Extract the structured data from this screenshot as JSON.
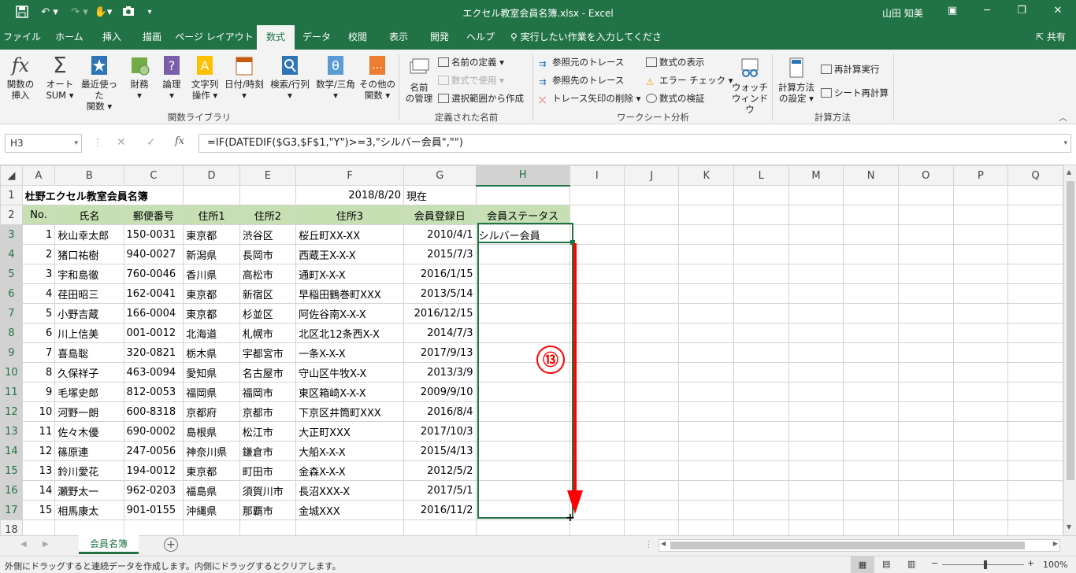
{
  "app": {
    "title": "エクセル教室会員名簿.xlsx  -  Excel",
    "user": "山田 知美",
    "share": "共有"
  },
  "tabs": [
    "ファイル",
    "ホーム",
    "挿入",
    "描画",
    "ページ レイアウト",
    "数式",
    "データ",
    "校閲",
    "表示",
    "開発",
    "ヘルプ"
  ],
  "search_placeholder": "実行したい作業を入力してください",
  "ribbon": {
    "fx_label1": "関数の",
    "fx_label2": "挿入",
    "sum1": "オート",
    "sum2": "SUM",
    "recent1": "最近使った",
    "recent2": "関数",
    "fin": "財務",
    "logic": "論理",
    "text1": "文字列",
    "text2": "操作",
    "date": "日付/時刻",
    "lookup": "検索/行列",
    "math": "数学/三角",
    "other1": "その他の",
    "other2": "関数",
    "grp_lib": "関数ライブラリ",
    "name1": "名前",
    "name2": "の管理",
    "define_name": "名前の定義",
    "use_formula": "数式で使用",
    "create_sel": "選択範囲から作成",
    "grp_names": "定義された名前",
    "trace_prec": "参照元のトレース",
    "trace_dep": "参照先のトレース",
    "remove_arrows": "トレース矢印の削除",
    "show_formulas": "数式の表示",
    "error_check": "エラー チェック",
    "eval_formula": "数式の検証",
    "watch1": "ウォッチ",
    "watch2": "ウィンドウ",
    "grp_audit": "ワークシート分析",
    "calc1": "計算方法",
    "calc2": "の設定",
    "calc_now": "再計算実行",
    "calc_sheet": "シート再計算",
    "grp_calc": "計算方法",
    "icon_fx": "fx",
    "icon_sum": "Σ"
  },
  "formula_bar": {
    "name_box": "H3",
    "fx": "fx",
    "formula": "=IF(DATEDIF($G3,$F$1,\"Y\")>=3,\"シルバー会員\",\"\")"
  },
  "columns": [
    "A",
    "B",
    "C",
    "D",
    "E",
    "F",
    "G",
    "H",
    "I",
    "J",
    "K",
    "L",
    "M",
    "N",
    "O",
    "P",
    "Q"
  ],
  "sheet": {
    "title": "杜野エクセル教室会員名簿",
    "ref_date": "2018/8/20",
    "ref_label": "現在",
    "headers": [
      "No.",
      "氏名",
      "郵便番号",
      "住所1",
      "住所2",
      "住所3",
      "会員登録日",
      "会員ステータス"
    ],
    "rows": [
      [
        "1",
        "秋山幸太郎",
        "150-0031",
        "東京都",
        "渋谷区",
        "桜丘町XX-XX",
        "2010/4/1",
        "シルバー会員"
      ],
      [
        "2",
        "猪口祐樹",
        "940-0027",
        "新潟県",
        "長岡市",
        "西蔵王X-X-X",
        "2015/7/3",
        ""
      ],
      [
        "3",
        "宇和島徹",
        "760-0046",
        "香川県",
        "高松市",
        "通町X-X-X",
        "2016/1/15",
        ""
      ],
      [
        "4",
        "荏田昭三",
        "162-0041",
        "東京都",
        "新宿区",
        "早稲田鶴巻町XXX",
        "2013/5/14",
        ""
      ],
      [
        "5",
        "小野吉蔵",
        "166-0004",
        "東京都",
        "杉並区",
        "阿佐谷南X-X-X",
        "2016/12/15",
        ""
      ],
      [
        "6",
        "川上信美",
        "001-0012",
        "北海道",
        "札幌市",
        "北区北12条西X-X",
        "2014/7/3",
        ""
      ],
      [
        "7",
        "喜島聡",
        "320-0821",
        "栃木県",
        "宇都宮市",
        "一条X-X-X",
        "2017/9/13",
        ""
      ],
      [
        "8",
        "久保祥子",
        "463-0094",
        "愛知県",
        "名古屋市",
        "守山区牛牧X-X",
        "2013/3/9",
        ""
      ],
      [
        "9",
        "毛塚史郎",
        "812-0053",
        "福岡県",
        "福岡市",
        "東区箱崎X-X-X",
        "2009/9/10",
        ""
      ],
      [
        "10",
        "河野一朗",
        "600-8318",
        "京都府",
        "京都市",
        "下京区井筒町XXX",
        "2016/8/4",
        ""
      ],
      [
        "11",
        "佐々木優",
        "690-0002",
        "島根県",
        "松江市",
        "大正町XXX",
        "2017/10/3",
        ""
      ],
      [
        "12",
        "篠原連",
        "247-0056",
        "神奈川県",
        "鎌倉市",
        "大船X-X-X",
        "2015/4/13",
        ""
      ],
      [
        "13",
        "鈴川愛花",
        "194-0012",
        "東京都",
        "町田市",
        "金森X-X-X",
        "2012/5/2",
        ""
      ],
      [
        "14",
        "瀬野太一",
        "962-0203",
        "福島県",
        "須賀川市",
        "長沼XXX-X",
        "2017/5/1",
        ""
      ],
      [
        "15",
        "相馬康太",
        "901-0155",
        "沖縄県",
        "那覇市",
        "金城XXX",
        "2016/11/2",
        ""
      ]
    ]
  },
  "annotation": "⑬",
  "sheet_tab": "会員名簿",
  "status": {
    "message": "外側にドラッグすると連続データを作成します。内側にドラッグするとクリアします。",
    "zoom": "100%"
  },
  "colors": {
    "excel_green": "#217346",
    "header_fill": "#c6e0b4",
    "arrow": "#ff0000"
  }
}
